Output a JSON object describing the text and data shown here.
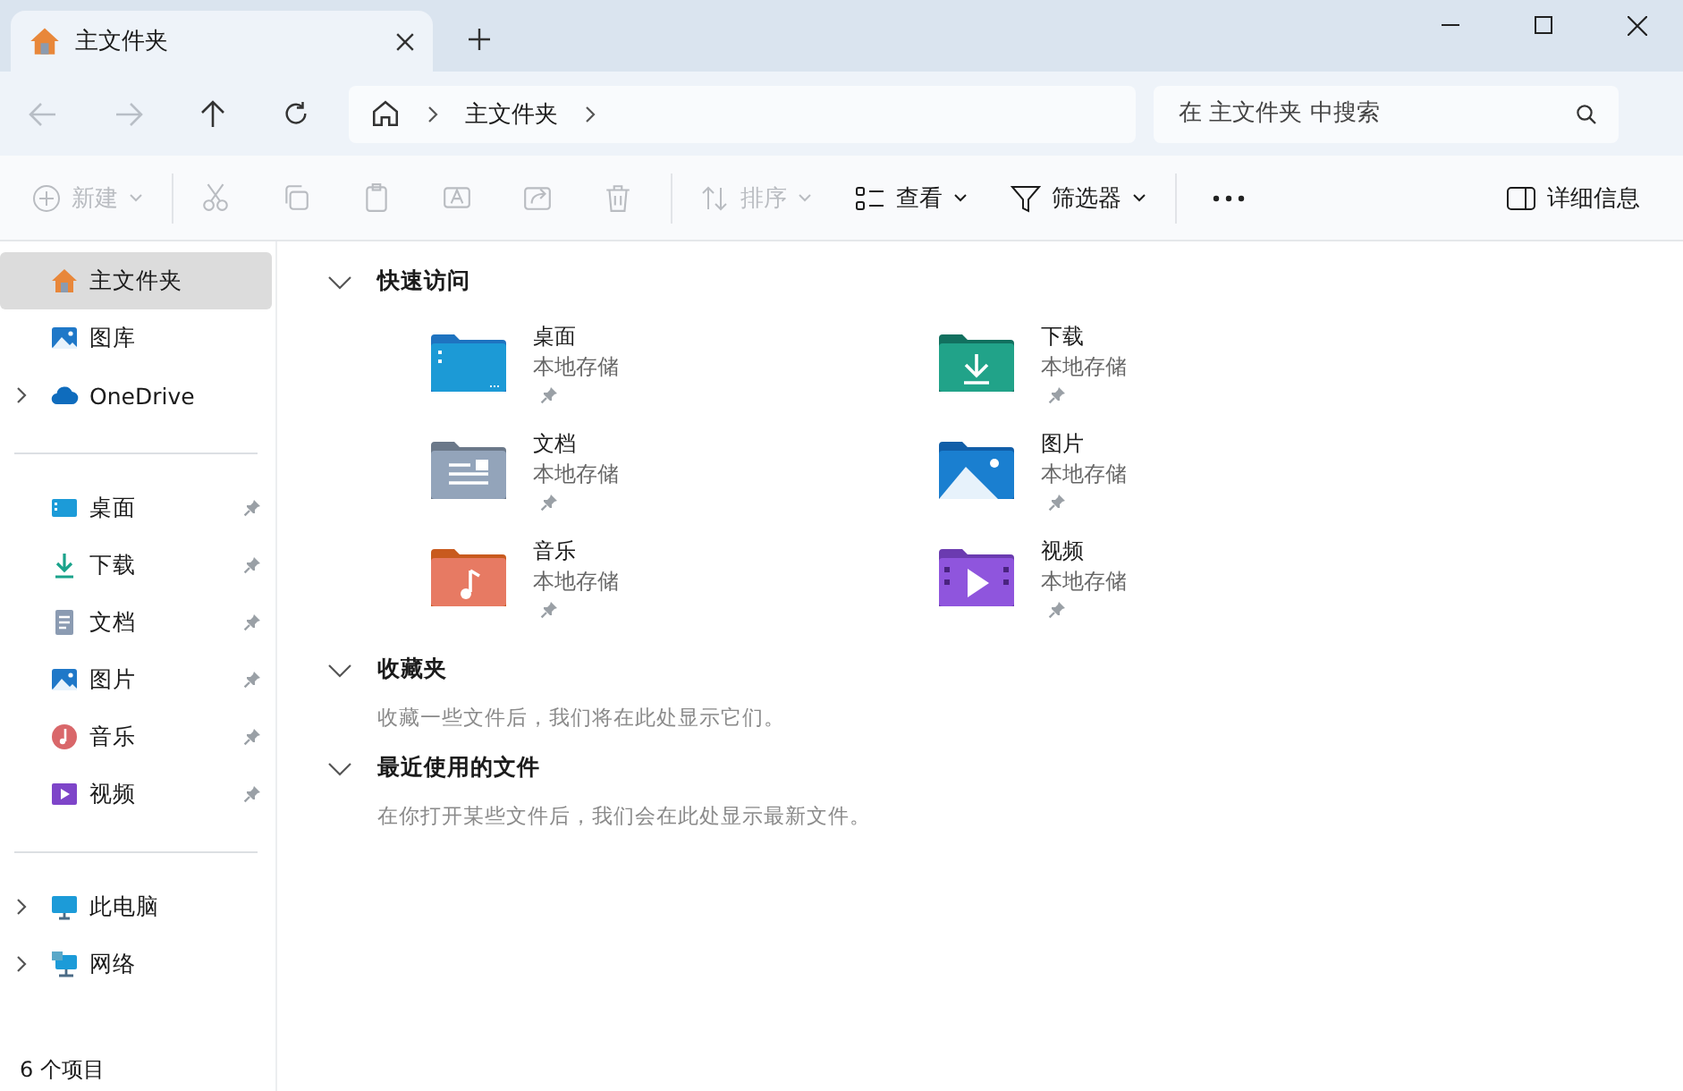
{
  "tabs": [
    {
      "label": "主文件夹",
      "selected": true
    }
  ],
  "nav": {
    "back_disabled": true,
    "forward_disabled": true
  },
  "address": {
    "crumbs": [
      "主文件夹"
    ]
  },
  "search": {
    "placeholder": "在 主文件夹 中搜索"
  },
  "toolbar": {
    "new": {
      "label": "新建",
      "disabled": true
    },
    "actions": [
      {
        "disabled": true
      },
      {
        "disabled": true
      },
      {
        "disabled": true
      },
      {
        "disabled": true
      },
      {
        "disabled": true
      },
      {
        "disabled": true
      }
    ],
    "sort": {
      "label": "排序",
      "disabled": true
    },
    "view": {
      "label": "查看",
      "disabled": false
    },
    "filter": {
      "label": "筛选器",
      "disabled": false
    },
    "details": {
      "label": "详细信息"
    }
  },
  "sidebar": {
    "groups": [
      {
        "items": [
          {
            "label": "主文件夹",
            "selected": true,
            "expandable": false,
            "pinned": false
          },
          {
            "label": "图库",
            "selected": false,
            "expandable": false,
            "pinned": false
          },
          {
            "label": "OneDrive",
            "selected": false,
            "expandable": true,
            "pinned": false
          }
        ]
      },
      {
        "items": [
          {
            "label": "桌面",
            "selected": false,
            "expandable": false,
            "pinned": true
          },
          {
            "label": "下载",
            "selected": false,
            "expandable": false,
            "pinned": true
          },
          {
            "label": "文档",
            "selected": false,
            "expandable": false,
            "pinned": true
          },
          {
            "label": "图片",
            "selected": false,
            "expandable": false,
            "pinned": true
          },
          {
            "label": "音乐",
            "selected": false,
            "expandable": false,
            "pinned": true
          },
          {
            "label": "视频",
            "selected": false,
            "expandable": false,
            "pinned": true
          }
        ]
      },
      {
        "items": [
          {
            "label": "此电脑",
            "selected": false,
            "expandable": true,
            "pinned": false
          },
          {
            "label": "网络",
            "selected": false,
            "expandable": true,
            "pinned": false
          }
        ]
      }
    ]
  },
  "sections": [
    {
      "title": "快速访问",
      "expanded": true,
      "items": [
        {
          "name": "桌面",
          "location": "本地存储",
          "pinned": true
        },
        {
          "name": "下载",
          "location": "本地存储",
          "pinned": true
        },
        {
          "name": "文档",
          "location": "本地存储",
          "pinned": true
        },
        {
          "name": "图片",
          "location": "本地存储",
          "pinned": true
        },
        {
          "name": "音乐",
          "location": "本地存储",
          "pinned": true
        },
        {
          "name": "视频",
          "location": "本地存储",
          "pinned": true
        }
      ]
    },
    {
      "title": "收藏夹",
      "expanded": true,
      "empty_text": "收藏一些文件后，我们将在此处显示它们。"
    },
    {
      "title": "最近使用的文件",
      "expanded": true,
      "empty_text": "在你打开某些文件后，我们会在此处显示最新文件。"
    }
  ],
  "status_bar": {
    "text": "6 个项目"
  }
}
